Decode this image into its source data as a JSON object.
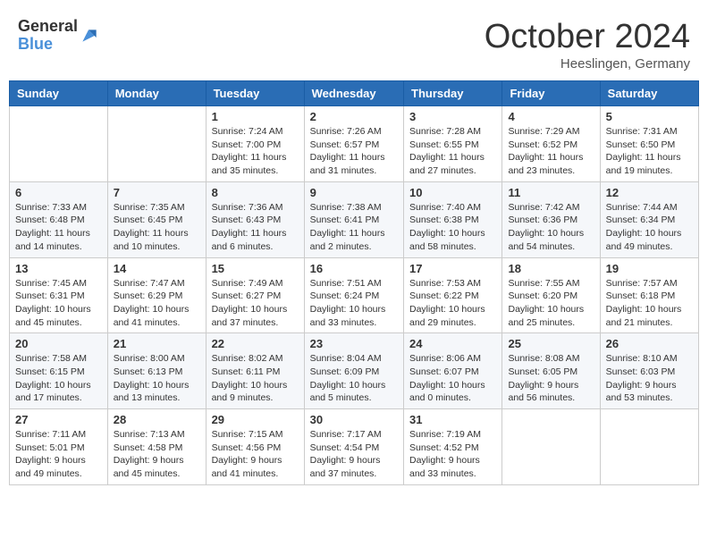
{
  "header": {
    "logo_general": "General",
    "logo_blue": "Blue",
    "month": "October 2024",
    "location": "Heeslingen, Germany"
  },
  "weekdays": [
    "Sunday",
    "Monday",
    "Tuesday",
    "Wednesday",
    "Thursday",
    "Friday",
    "Saturday"
  ],
  "weeks": [
    [
      null,
      null,
      {
        "day": "1",
        "sunrise": "Sunrise: 7:24 AM",
        "sunset": "Sunset: 7:00 PM",
        "daylight": "Daylight: 11 hours and 35 minutes."
      },
      {
        "day": "2",
        "sunrise": "Sunrise: 7:26 AM",
        "sunset": "Sunset: 6:57 PM",
        "daylight": "Daylight: 11 hours and 31 minutes."
      },
      {
        "day": "3",
        "sunrise": "Sunrise: 7:28 AM",
        "sunset": "Sunset: 6:55 PM",
        "daylight": "Daylight: 11 hours and 27 minutes."
      },
      {
        "day": "4",
        "sunrise": "Sunrise: 7:29 AM",
        "sunset": "Sunset: 6:52 PM",
        "daylight": "Daylight: 11 hours and 23 minutes."
      },
      {
        "day": "5",
        "sunrise": "Sunrise: 7:31 AM",
        "sunset": "Sunset: 6:50 PM",
        "daylight": "Daylight: 11 hours and 19 minutes."
      }
    ],
    [
      {
        "day": "6",
        "sunrise": "Sunrise: 7:33 AM",
        "sunset": "Sunset: 6:48 PM",
        "daylight": "Daylight: 11 hours and 14 minutes."
      },
      {
        "day": "7",
        "sunrise": "Sunrise: 7:35 AM",
        "sunset": "Sunset: 6:45 PM",
        "daylight": "Daylight: 11 hours and 10 minutes."
      },
      {
        "day": "8",
        "sunrise": "Sunrise: 7:36 AM",
        "sunset": "Sunset: 6:43 PM",
        "daylight": "Daylight: 11 hours and 6 minutes."
      },
      {
        "day": "9",
        "sunrise": "Sunrise: 7:38 AM",
        "sunset": "Sunset: 6:41 PM",
        "daylight": "Daylight: 11 hours and 2 minutes."
      },
      {
        "day": "10",
        "sunrise": "Sunrise: 7:40 AM",
        "sunset": "Sunset: 6:38 PM",
        "daylight": "Daylight: 10 hours and 58 minutes."
      },
      {
        "day": "11",
        "sunrise": "Sunrise: 7:42 AM",
        "sunset": "Sunset: 6:36 PM",
        "daylight": "Daylight: 10 hours and 54 minutes."
      },
      {
        "day": "12",
        "sunrise": "Sunrise: 7:44 AM",
        "sunset": "Sunset: 6:34 PM",
        "daylight": "Daylight: 10 hours and 49 minutes."
      }
    ],
    [
      {
        "day": "13",
        "sunrise": "Sunrise: 7:45 AM",
        "sunset": "Sunset: 6:31 PM",
        "daylight": "Daylight: 10 hours and 45 minutes."
      },
      {
        "day": "14",
        "sunrise": "Sunrise: 7:47 AM",
        "sunset": "Sunset: 6:29 PM",
        "daylight": "Daylight: 10 hours and 41 minutes."
      },
      {
        "day": "15",
        "sunrise": "Sunrise: 7:49 AM",
        "sunset": "Sunset: 6:27 PM",
        "daylight": "Daylight: 10 hours and 37 minutes."
      },
      {
        "day": "16",
        "sunrise": "Sunrise: 7:51 AM",
        "sunset": "Sunset: 6:24 PM",
        "daylight": "Daylight: 10 hours and 33 minutes."
      },
      {
        "day": "17",
        "sunrise": "Sunrise: 7:53 AM",
        "sunset": "Sunset: 6:22 PM",
        "daylight": "Daylight: 10 hours and 29 minutes."
      },
      {
        "day": "18",
        "sunrise": "Sunrise: 7:55 AM",
        "sunset": "Sunset: 6:20 PM",
        "daylight": "Daylight: 10 hours and 25 minutes."
      },
      {
        "day": "19",
        "sunrise": "Sunrise: 7:57 AM",
        "sunset": "Sunset: 6:18 PM",
        "daylight": "Daylight: 10 hours and 21 minutes."
      }
    ],
    [
      {
        "day": "20",
        "sunrise": "Sunrise: 7:58 AM",
        "sunset": "Sunset: 6:15 PM",
        "daylight": "Daylight: 10 hours and 17 minutes."
      },
      {
        "day": "21",
        "sunrise": "Sunrise: 8:00 AM",
        "sunset": "Sunset: 6:13 PM",
        "daylight": "Daylight: 10 hours and 13 minutes."
      },
      {
        "day": "22",
        "sunrise": "Sunrise: 8:02 AM",
        "sunset": "Sunset: 6:11 PM",
        "daylight": "Daylight: 10 hours and 9 minutes."
      },
      {
        "day": "23",
        "sunrise": "Sunrise: 8:04 AM",
        "sunset": "Sunset: 6:09 PM",
        "daylight": "Daylight: 10 hours and 5 minutes."
      },
      {
        "day": "24",
        "sunrise": "Sunrise: 8:06 AM",
        "sunset": "Sunset: 6:07 PM",
        "daylight": "Daylight: 10 hours and 0 minutes."
      },
      {
        "day": "25",
        "sunrise": "Sunrise: 8:08 AM",
        "sunset": "Sunset: 6:05 PM",
        "daylight": "Daylight: 9 hours and 56 minutes."
      },
      {
        "day": "26",
        "sunrise": "Sunrise: 8:10 AM",
        "sunset": "Sunset: 6:03 PM",
        "daylight": "Daylight: 9 hours and 53 minutes."
      }
    ],
    [
      {
        "day": "27",
        "sunrise": "Sunrise: 7:11 AM",
        "sunset": "Sunset: 5:01 PM",
        "daylight": "Daylight: 9 hours and 49 minutes."
      },
      {
        "day": "28",
        "sunrise": "Sunrise: 7:13 AM",
        "sunset": "Sunset: 4:58 PM",
        "daylight": "Daylight: 9 hours and 45 minutes."
      },
      {
        "day": "29",
        "sunrise": "Sunrise: 7:15 AM",
        "sunset": "Sunset: 4:56 PM",
        "daylight": "Daylight: 9 hours and 41 minutes."
      },
      {
        "day": "30",
        "sunrise": "Sunrise: 7:17 AM",
        "sunset": "Sunset: 4:54 PM",
        "daylight": "Daylight: 9 hours and 37 minutes."
      },
      {
        "day": "31",
        "sunrise": "Sunrise: 7:19 AM",
        "sunset": "Sunset: 4:52 PM",
        "daylight": "Daylight: 9 hours and 33 minutes."
      },
      null,
      null
    ]
  ]
}
